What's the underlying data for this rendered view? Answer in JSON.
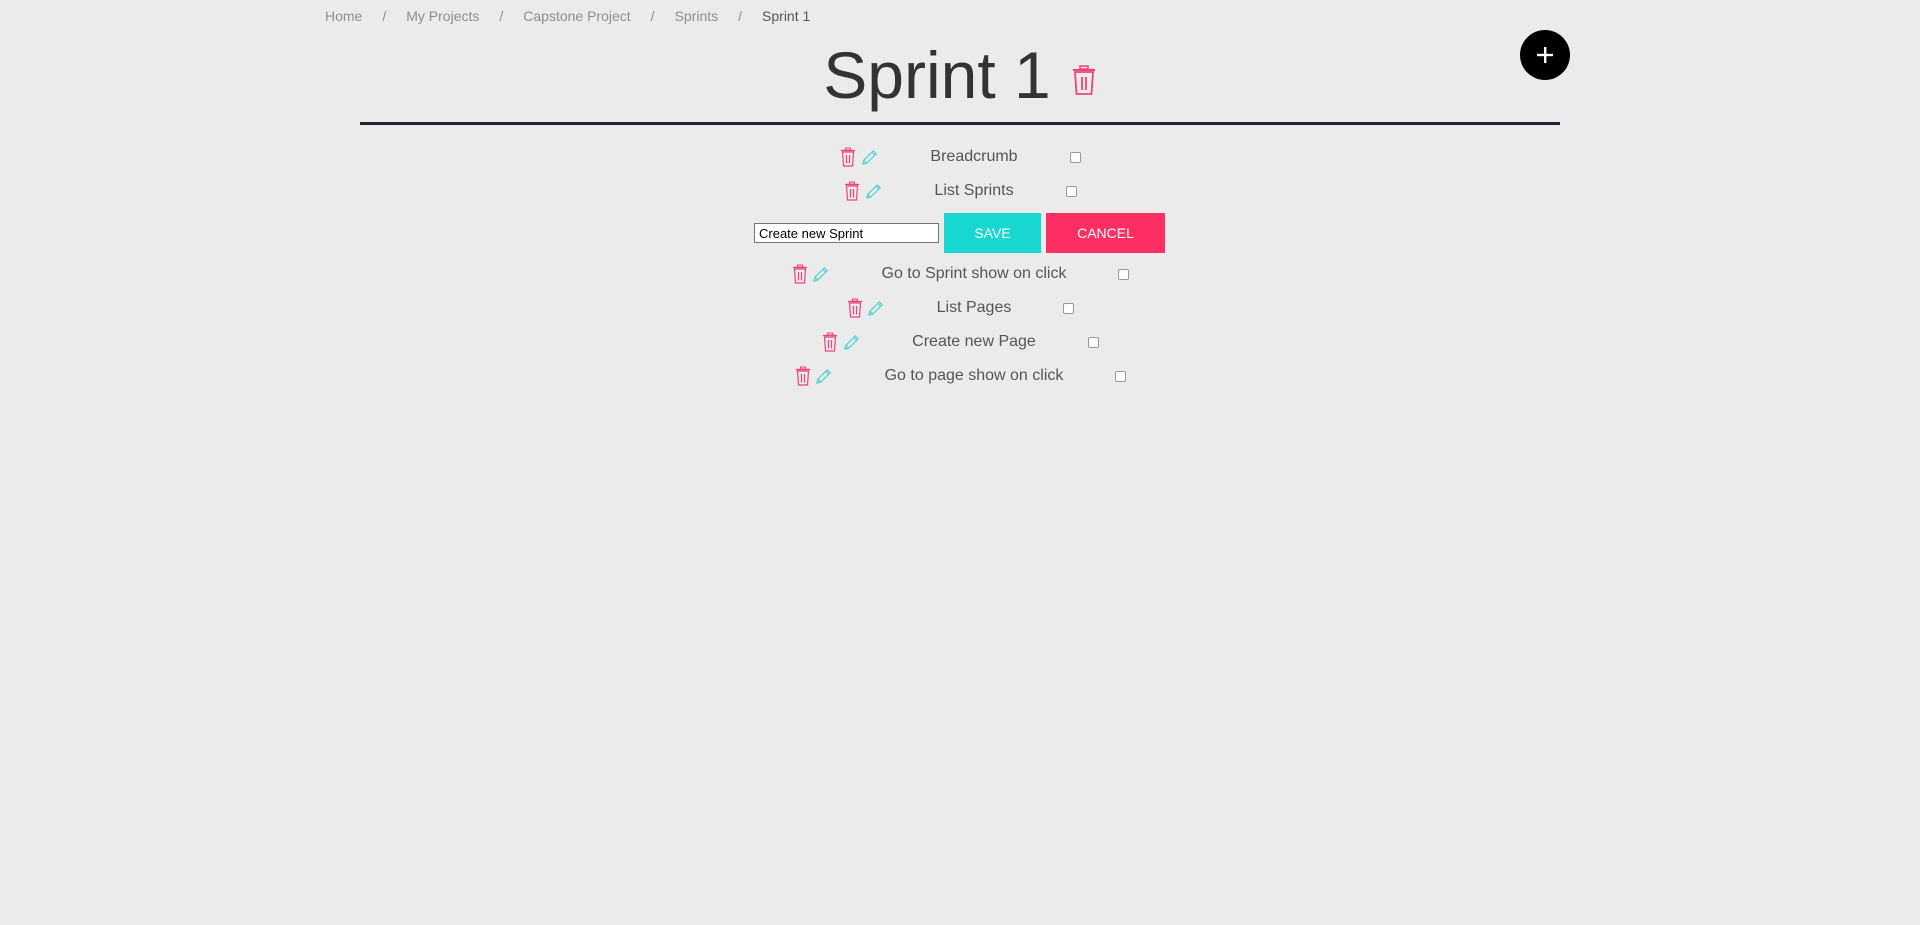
{
  "breadcrumb": {
    "items": [
      "Home",
      "My Projects",
      "Capstone Project",
      "Sprints",
      "Sprint 1"
    ],
    "separator": "/"
  },
  "fab": {
    "icon": "plus-icon"
  },
  "title": {
    "text": "Sprint 1",
    "icon": "trash-icon"
  },
  "colors": {
    "delete": "#f0437a",
    "edit": "#3ed3ce",
    "save": "#18d6d0",
    "cancel": "#ff2e63",
    "fab": "#000000"
  },
  "tasks_before": [
    {
      "label": "Breadcrumb",
      "checked": false
    },
    {
      "label": "List Sprints",
      "checked": false
    }
  ],
  "edit_form": {
    "value": "Create new Sprint",
    "save_label": "SAVE",
    "cancel_label": "CANCEL"
  },
  "tasks_after": [
    {
      "label": "Go to Sprint show on click",
      "checked": false
    },
    {
      "label": "List Pages",
      "checked": false
    },
    {
      "label": "Create new Page",
      "checked": false
    },
    {
      "label": "Go to page show on click",
      "checked": false
    }
  ]
}
